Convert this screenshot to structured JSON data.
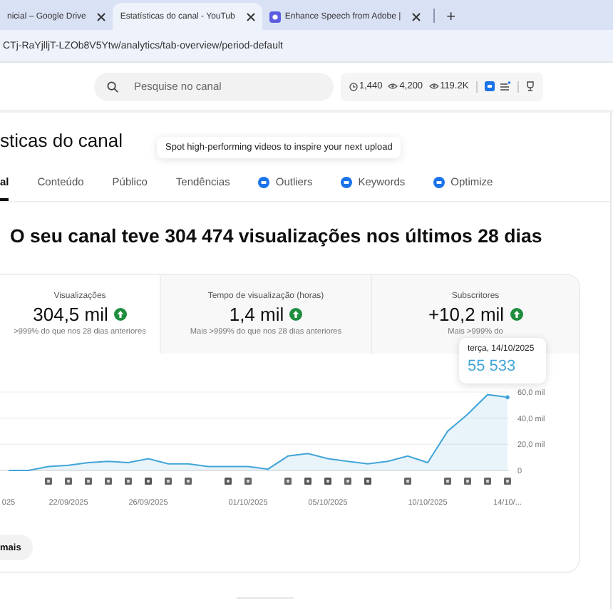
{
  "browser": {
    "tabs": [
      {
        "title": "nicial – Google Drive",
        "selected": false,
        "kind": "plain"
      },
      {
        "title": "Estatísticas do canal - YouTub",
        "selected": true,
        "kind": "video"
      },
      {
        "title": "Enhance Speech from Adobe |",
        "selected": false,
        "kind": "app"
      }
    ],
    "new_tab": "+",
    "address": "CTj-RaYjlljT-LZOb8V5Ytw/analytics/tab-overview/period-default"
  },
  "header": {
    "search": {
      "placeholder": "Pesquise no canal"
    },
    "stats": [
      {
        "kind": "clock",
        "value": "1,440"
      },
      {
        "kind": "eye",
        "value": "4,200"
      },
      {
        "kind": "eye",
        "value": "119.2K"
      }
    ]
  },
  "page": {
    "title": "sticas do canal",
    "hint": "Spot high-performing videos to inspire your next upload",
    "tabs": [
      {
        "label": "al",
        "selected": true,
        "kind": "plain"
      },
      {
        "label": "Conteúdo",
        "selected": false,
        "kind": "plain"
      },
      {
        "label": "Público",
        "selected": false,
        "kind": "plain"
      },
      {
        "label": "Tendências",
        "selected": false,
        "kind": "plain"
      },
      {
        "label": "Outliers",
        "selected": false,
        "kind": "extension"
      },
      {
        "label": "Keywords",
        "selected": false,
        "kind": "extension"
      },
      {
        "label": "Optimize",
        "selected": false,
        "kind": "extension"
      }
    ],
    "headline": "O seu canal teve 304 474 visualizações nos últimos 28 dias",
    "metrics": [
      {
        "label": "Visualizações",
        "value": "304,5 mil",
        "rising": true,
        "note": ">999% do que nos 28 dias anteriores",
        "selected": true
      },
      {
        "label": "Tempo de visualização (horas)",
        "value": "1,4 mil",
        "rising": true,
        "note": "Mais >999% do que nos 28 dias anteriores",
        "selected": false
      },
      {
        "label": "Subscritores",
        "value": "+10,2 mil",
        "rising": true,
        "note": "Mais >999% do",
        "selected": false
      }
    ],
    "chart_data": {
      "type": "area",
      "categories": [
        "025",
        null,
        null,
        "22/09/2025",
        null,
        null,
        null,
        "26/09/2025",
        null,
        null,
        null,
        null,
        "01/10/2025",
        null,
        null,
        null,
        "05/10/2025",
        null,
        null,
        null,
        null,
        "10/10/2025",
        null,
        null,
        null,
        "14/10/..."
      ],
      "series": [
        {
          "color": "#41a5d8",
          "values": [
            0,
            0,
            3,
            4,
            6,
            7,
            6,
            9,
            5,
            5,
            3,
            3,
            3,
            1,
            11,
            13,
            9,
            7,
            5,
            7,
            11,
            6,
            30,
            43,
            58,
            56
          ]
        }
      ],
      "ylim": [
        0,
        60
      ],
      "yticks": [
        {
          "value": 0,
          "label": "0"
        },
        {
          "value": 20,
          "label": "20,0 mil"
        },
        {
          "value": 40,
          "label": "40,0 mil"
        },
        {
          "value": 60,
          "label": "60,0 mil"
        }
      ]
    },
    "tooltip": {
      "date": "terça, 14/10/2025",
      "value": "55 533"
    },
    "more_button": "mais"
  }
}
